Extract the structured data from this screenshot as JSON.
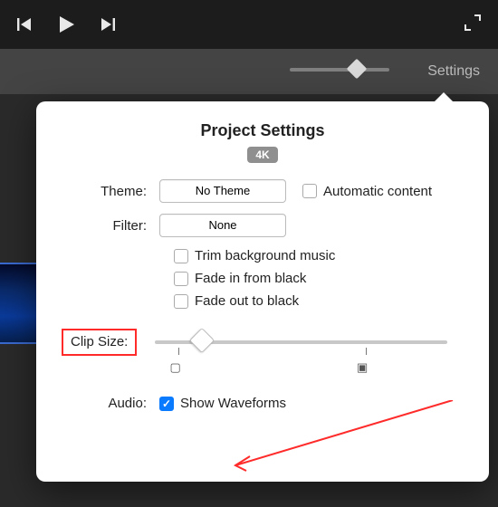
{
  "playbar": {
    "prev": "skip-back",
    "play": "play",
    "next": "skip-forward",
    "expand": "expand"
  },
  "toolbar": {
    "settings_label": "Settings"
  },
  "popover": {
    "title": "Project Settings",
    "badge": "4K",
    "theme_label": "Theme:",
    "theme_value": "No Theme",
    "auto_content_label": "Automatic content",
    "filter_label": "Filter:",
    "filter_value": "None",
    "opt_trim": "Trim background music",
    "opt_fadein": "Fade in from black",
    "opt_fadeout": "Fade out to black",
    "clip_size_label": "Clip Size:",
    "audio_label": "Audio:",
    "show_waveforms_label": "Show Waveforms"
  }
}
